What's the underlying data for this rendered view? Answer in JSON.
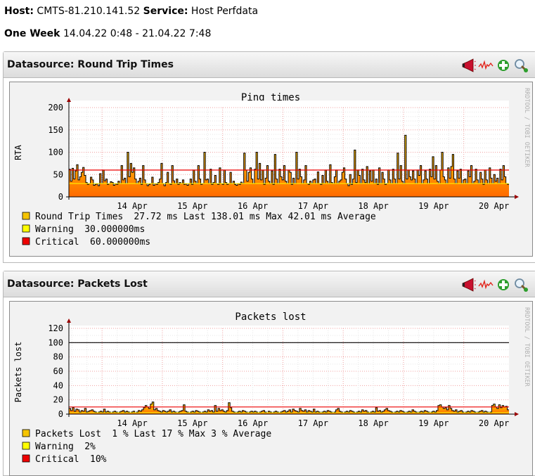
{
  "header": {
    "host_label": "Host:",
    "host_value": "CMTS-81.210.141.52",
    "service_label": "Service:",
    "service_value": "Host Perfdata",
    "period_label": "One Week",
    "period_value": "14.04.22 0:48 - 21.04.22 7:48"
  },
  "panels": [
    {
      "title": "Datasource: Round Trip Times",
      "graph": {
        "title": "Ping times",
        "ylabel": "RTA",
        "watermark": "RRDTOOL / TOBI OETIKER",
        "yticks": [
          "200",
          "150",
          "100",
          "50",
          "0"
        ],
        "xticks": [
          "14 Apr",
          "15 Apr",
          "16 Apr",
          "17 Apr",
          "18 Apr",
          "19 Apr",
          "20 Apr"
        ],
        "legend": [
          {
            "name": "Round Trip Times",
            "stats": "27.72 ms Last   138.01 ms Max    42.01 ms Average",
            "color": "#f5c400"
          },
          {
            "name": "Warning",
            "stats": "30.000000ms",
            "color": "#ffff00"
          },
          {
            "name": "Critical",
            "stats": "60.000000ms",
            "color": "#ee0000"
          }
        ]
      }
    },
    {
      "title": "Datasource: Packets Lost",
      "graph": {
        "title": "Packets lost",
        "ylabel": "Packets lost",
        "watermark": "RRDTOOL / TOBI OETIKER",
        "yticks": [
          "120",
          "100",
          "80",
          "60",
          "40",
          "20",
          "0"
        ],
        "xticks": [
          "14 Apr",
          "15 Apr",
          "16 Apr",
          "17 Apr",
          "18 Apr",
          "19 Apr",
          "20 Apr"
        ],
        "legend": [
          {
            "name": "Packets Lost",
            "stats": "1 % Last    17 % Max     3 % Average",
            "color": "#f5c400"
          },
          {
            "name": "Warning",
            "stats": "2%",
            "color": "#ffff00"
          },
          {
            "name": "Critical",
            "stats": "10%",
            "color": "#ee0000"
          }
        ]
      }
    }
  ],
  "chart_data": [
    {
      "type": "area",
      "title": "Ping times",
      "ylabel": "RTA",
      "xlabel": "",
      "ylim": [
        0,
        200
      ],
      "x_ticks": [
        "14 Apr",
        "15 Apr",
        "16 Apr",
        "17 Apr",
        "18 Apr",
        "19 Apr",
        "20 Apr"
      ],
      "grid": true,
      "series": [
        {
          "name": "Round Trip Times",
          "last": 27.72,
          "max": 138.01,
          "average": 42.01,
          "unit": "ms"
        }
      ],
      "thresholds": {
        "warning": 30,
        "critical": 60
      },
      "values": [
        62,
        35,
        64,
        40,
        58,
        72,
        38,
        45,
        55,
        66,
        48,
        32,
        28,
        30,
        44,
        38,
        26,
        28,
        30,
        25,
        52,
        30,
        60,
        36,
        40,
        28,
        30,
        34,
        32,
        26,
        30,
        28,
        35,
        30,
        70,
        38,
        42,
        30,
        100,
        45,
        75,
        55,
        65,
        40,
        30,
        35,
        42,
        28,
        70,
        38,
        30,
        25,
        28,
        30,
        44,
        26,
        30,
        28,
        32,
        40,
        75,
        30,
        25,
        32,
        55,
        30,
        28,
        70,
        36,
        30,
        40,
        28,
        32,
        30,
        38,
        28,
        30,
        26,
        30,
        40,
        28,
        60,
        35,
        30,
        70,
        40,
        28,
        30,
        100,
        38,
        40,
        30,
        62,
        28,
        32,
        48,
        30,
        28,
        65,
        30,
        28,
        60,
        32,
        28,
        30,
        55,
        30,
        35,
        28,
        26,
        30,
        28,
        33,
        30,
        98,
        60,
        35,
        55,
        65,
        40,
        30,
        62,
        100,
        40,
        75,
        38,
        60,
        28,
        42,
        70,
        35,
        30,
        58,
        28,
        95,
        40,
        30,
        62,
        45,
        38,
        70,
        35,
        30,
        60,
        55,
        28,
        42,
        30,
        100,
        40,
        62,
        45,
        30,
        38,
        70,
        30,
        28,
        35,
        30,
        38,
        40,
        30,
        56,
        30,
        28,
        48,
        30,
        60,
        35,
        30,
        72,
        32,
        30,
        45,
        60,
        30,
        35,
        38,
        55,
        65,
        40,
        30,
        25,
        50,
        28,
        40,
        105,
        32,
        60,
        48,
        30,
        62,
        38,
        32,
        68,
        30,
        58,
        35,
        60,
        30,
        40,
        28,
        65,
        30,
        55,
        40,
        28,
        30,
        60,
        38,
        30,
        62,
        40,
        30,
        98,
        40,
        70,
        35,
        30,
        138,
        40,
        60,
        45,
        38,
        58,
        40,
        30,
        60,
        48,
        70,
        30,
        38,
        58,
        40,
        30,
        62,
        45,
        90,
        40,
        70,
        35,
        30,
        60,
        100,
        45,
        38,
        30,
        65,
        42,
        68,
        95,
        40,
        30,
        58,
        42,
        62,
        30,
        38,
        40,
        30,
        58,
        45,
        70,
        30,
        35,
        62,
        38,
        30,
        55,
        40,
        28,
        60,
        38,
        30,
        65,
        42,
        30,
        50,
        35,
        42,
        30,
        62,
        38,
        70,
        45,
        30,
        28
      ]
    },
    {
      "type": "area",
      "title": "Packets lost",
      "ylabel": "Packets lost",
      "xlabel": "",
      "ylim": [
        0,
        120
      ],
      "x_ticks": [
        "14 Apr",
        "15 Apr",
        "16 Apr",
        "17 Apr",
        "18 Apr",
        "19 Apr",
        "20 Apr"
      ],
      "grid": true,
      "series": [
        {
          "name": "Packets Lost",
          "last": 1,
          "max": 17,
          "average": 3,
          "unit": "%"
        }
      ],
      "thresholds": {
        "warning": 2,
        "critical": 10
      },
      "reference_line": 100,
      "values": [
        8,
        5,
        9,
        4,
        7,
        6,
        3,
        5,
        4,
        8,
        3,
        4,
        5,
        6,
        4,
        3,
        2,
        3,
        4,
        3,
        7,
        3,
        4,
        3,
        2,
        3,
        4,
        3,
        2,
        3,
        4,
        5,
        3,
        4,
        3,
        2,
        3,
        4,
        2,
        3,
        5,
        4,
        6,
        9,
        12,
        10,
        8,
        14,
        17,
        6,
        8,
        5,
        4,
        3,
        5,
        4,
        3,
        4,
        6,
        3,
        4,
        3,
        2,
        3,
        4,
        5,
        13,
        4,
        3,
        2,
        3,
        4,
        3,
        5,
        4,
        3,
        2,
        3,
        4,
        3,
        6,
        4,
        5,
        3,
        12,
        4,
        8,
        5,
        6,
        4,
        3,
        5,
        16,
        9,
        4,
        3,
        2,
        3,
        4,
        3,
        5,
        4,
        3,
        2,
        3,
        4,
        3,
        4,
        3,
        2,
        3,
        4,
        5,
        3,
        2,
        4,
        3,
        2,
        3,
        4,
        3,
        2,
        3,
        4,
        5,
        3,
        4,
        6,
        3,
        7,
        5,
        4,
        3,
        8,
        5,
        4,
        6,
        3,
        5,
        4,
        3,
        7,
        3,
        4,
        3,
        2,
        3,
        4,
        3,
        5,
        4,
        3,
        2,
        3,
        6,
        8,
        4,
        3,
        2,
        3,
        4,
        3,
        5,
        4,
        3,
        2,
        3,
        4,
        3,
        6,
        4,
        5,
        3,
        2,
        3,
        4,
        3,
        9,
        4,
        5,
        3,
        4,
        6,
        8,
        5,
        4,
        3,
        2,
        3,
        4,
        3,
        5,
        4,
        3,
        2,
        3,
        4,
        3,
        6,
        4,
        3,
        2,
        3,
        4,
        3,
        5,
        4,
        3,
        2,
        3,
        4,
        3,
        5,
        12,
        13,
        10,
        8,
        9,
        6,
        12,
        8,
        5,
        4,
        6,
        3,
        4,
        5,
        3,
        2,
        3,
        4,
        3,
        5,
        4,
        3,
        2,
        3,
        4,
        5,
        3,
        4,
        3,
        2,
        3,
        12,
        14,
        10,
        8,
        13,
        9,
        12,
        10,
        11,
        6
      ]
    }
  ]
}
